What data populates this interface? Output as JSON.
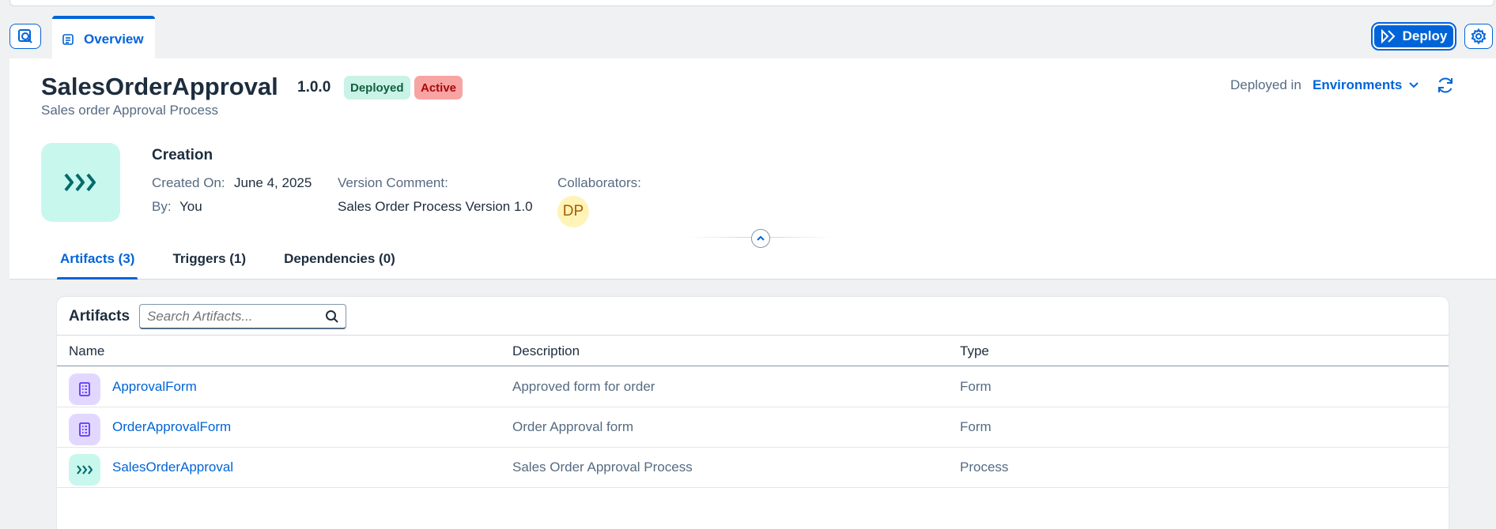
{
  "tabbar": {
    "overview_label": "Overview",
    "deploy_label": "Deploy"
  },
  "header": {
    "title": "SalesOrderApproval",
    "version": "1.0.0",
    "status_deployed": "Deployed",
    "status_active": "Active",
    "subtitle": "Sales order Approval Process",
    "deployed_in_label": "Deployed in",
    "environments_label": "Environments"
  },
  "creation": {
    "section_title": "Creation",
    "created_on_label": "Created On:",
    "created_on_value": "June 4, 2025",
    "by_label": "By:",
    "by_value": "You",
    "version_comment_label": "Version Comment:",
    "version_comment_value": "Sales Order Process Version 1.0",
    "collaborators_label": "Collaborators:",
    "collaborator_initials": "DP"
  },
  "tabs": [
    {
      "label": "Artifacts (3)",
      "active": true
    },
    {
      "label": "Triggers (1)",
      "active": false
    },
    {
      "label": "Dependencies (0)",
      "active": false
    }
  ],
  "artifacts": {
    "title": "Artifacts",
    "search_placeholder": "Search Artifacts...",
    "columns": {
      "name": "Name",
      "description": "Description",
      "type": "Type"
    },
    "rows": [
      {
        "name": "ApprovalForm",
        "description": "Approved form for order",
        "type": "Form",
        "icon": "form-icon"
      },
      {
        "name": "OrderApprovalForm",
        "description": "Order Approval form",
        "type": "Form",
        "icon": "form-icon"
      },
      {
        "name": "SalesOrderApproval",
        "description": "Sales Order Approval Process",
        "type": "Process",
        "icon": "process-icon"
      }
    ]
  },
  "colors": {
    "accent": "#0064d9",
    "deployed_badge": "#c8f3e6",
    "active_badge": "#f7a4a3",
    "process_tile": "#c8f7ee",
    "form_tile": "#e2d8ff"
  }
}
